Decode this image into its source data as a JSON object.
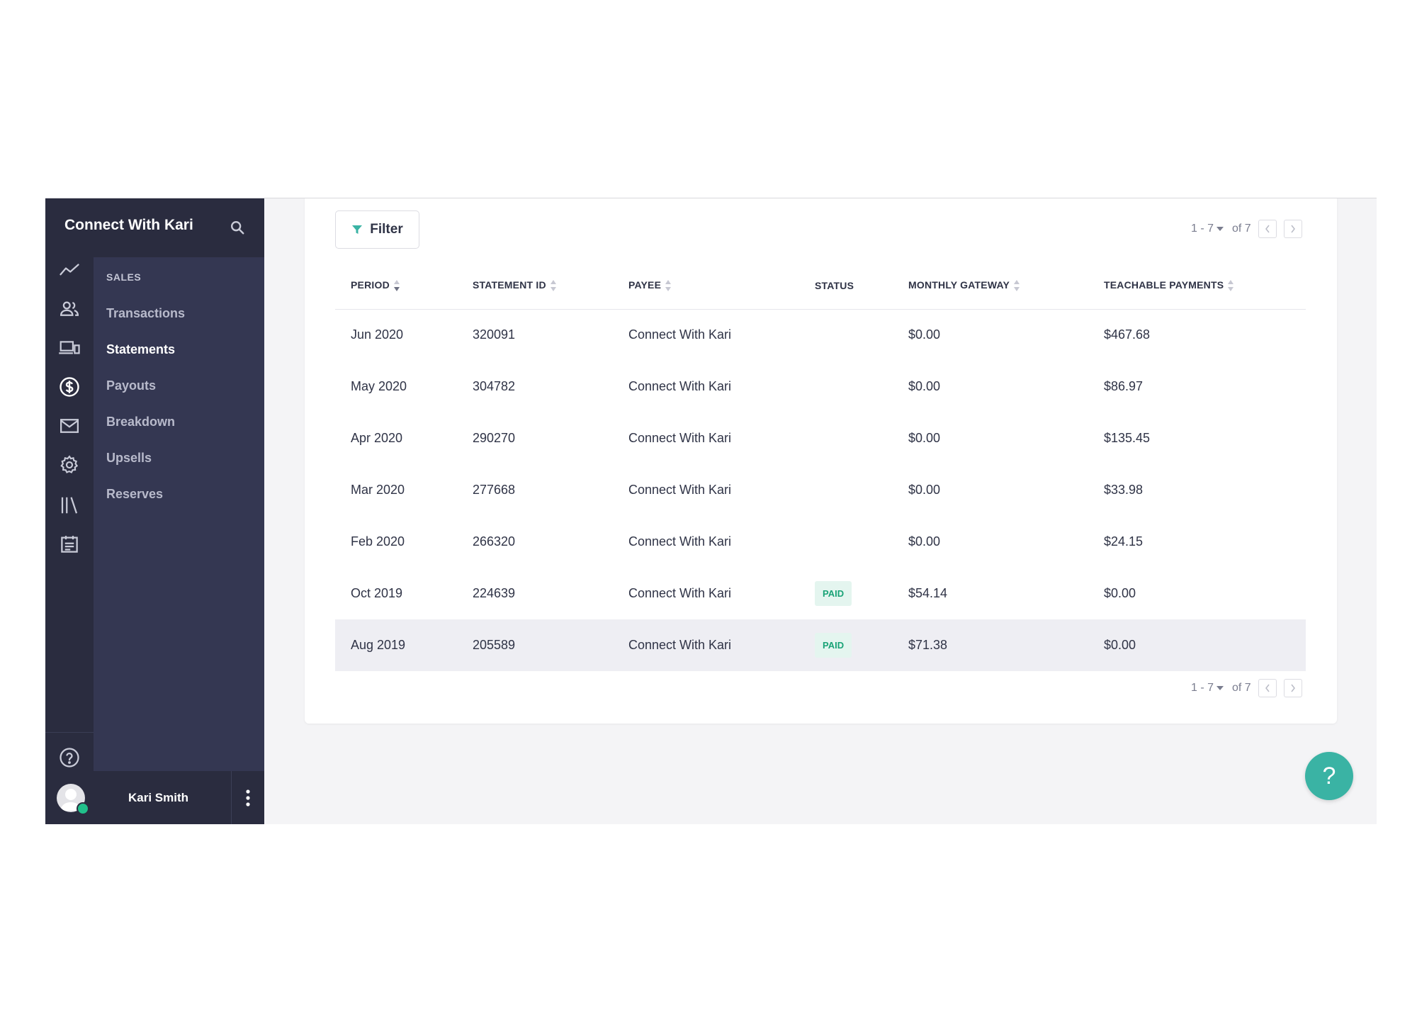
{
  "sidebar": {
    "school_name": "Connect With Kari",
    "section_label": "SALES",
    "items": [
      {
        "label": "Transactions",
        "active": false
      },
      {
        "label": "Statements",
        "active": true
      },
      {
        "label": "Payouts",
        "active": false
      },
      {
        "label": "Breakdown",
        "active": false
      },
      {
        "label": "Upsells",
        "active": false
      },
      {
        "label": "Reserves",
        "active": false
      }
    ],
    "rail_icons": [
      "analytics-icon",
      "users-icon",
      "devices-icon",
      "dollar-icon",
      "mail-icon",
      "gear-icon",
      "library-icon",
      "calendar-icon",
      "help-circle-icon",
      "graduation-cap-icon"
    ],
    "user_name": "Kari Smith"
  },
  "toolbar": {
    "filter_label": "Filter"
  },
  "pagination": {
    "range": "1 - 7",
    "of": "of 7"
  },
  "table": {
    "columns": [
      "PERIOD",
      "STATEMENT ID",
      "PAYEE",
      "STATUS",
      "MONTHLY GATEWAY",
      "TEACHABLE PAYMENTS"
    ],
    "rows": [
      {
        "period": "Jun 2020",
        "statement_id": "320091",
        "payee": "Connect With Kari",
        "status": "",
        "monthly_gateway": "$0.00",
        "teachable_payments": "$467.68"
      },
      {
        "period": "May 2020",
        "statement_id": "304782",
        "payee": "Connect With Kari",
        "status": "",
        "monthly_gateway": "$0.00",
        "teachable_payments": "$86.97"
      },
      {
        "period": "Apr 2020",
        "statement_id": "290270",
        "payee": "Connect With Kari",
        "status": "",
        "monthly_gateway": "$0.00",
        "teachable_payments": "$135.45"
      },
      {
        "period": "Mar 2020",
        "statement_id": "277668",
        "payee": "Connect With Kari",
        "status": "",
        "monthly_gateway": "$0.00",
        "teachable_payments": "$33.98"
      },
      {
        "period": "Feb 2020",
        "statement_id": "266320",
        "payee": "Connect With Kari",
        "status": "",
        "monthly_gateway": "$0.00",
        "teachable_payments": "$24.15"
      },
      {
        "period": "Oct 2019",
        "statement_id": "224639",
        "payee": "Connect With Kari",
        "status": "PAID",
        "monthly_gateway": "$54.14",
        "teachable_payments": "$0.00"
      },
      {
        "period": "Aug 2019",
        "statement_id": "205589",
        "payee": "Connect With Kari",
        "status": "PAID",
        "monthly_gateway": "$71.38",
        "teachable_payments": "$0.00"
      }
    ]
  },
  "help_fab": "?",
  "colors": {
    "sidebar_dark": "#2a2c3f",
    "sidebar": "#343752",
    "accent": "#3ab3a4",
    "paid_text": "#1aa377",
    "paid_bg": "#e4f5ef"
  }
}
